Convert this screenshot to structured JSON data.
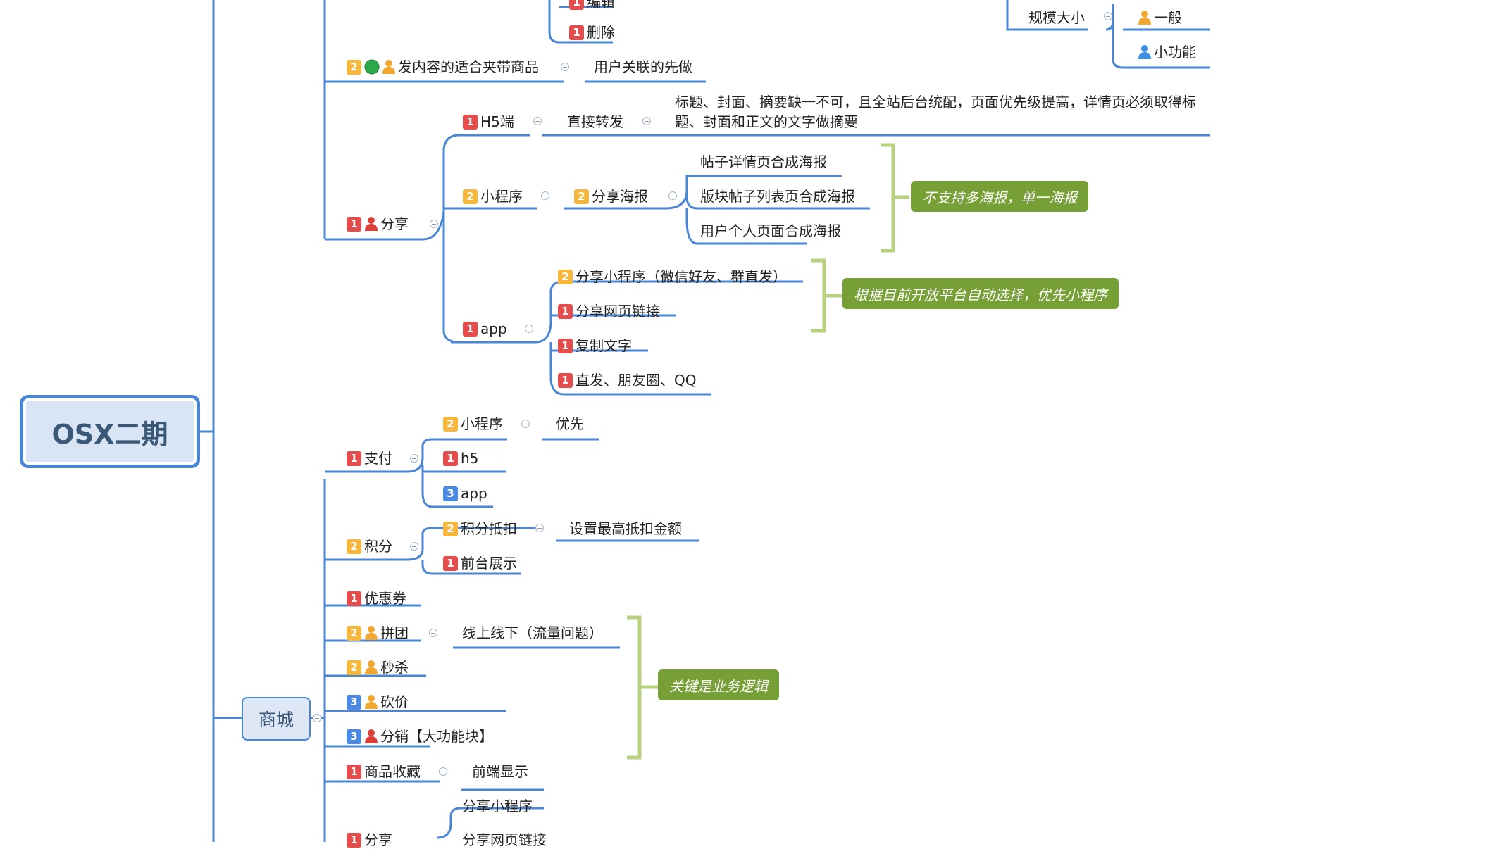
{
  "root": {
    "title": "OSX二期"
  },
  "colors": {
    "line": "#4a86d4",
    "brace": "#b7d17e",
    "note_bg": "#76a035",
    "p1": "#e54d4d",
    "p2": "#f6b73c",
    "p3": "#4a8ae2"
  },
  "top": {
    "edit": "编辑",
    "delete": "删除",
    "scale": "规模大小",
    "normal": "一般",
    "small_feature": "小功能",
    "content_goods": "发内容的适合夹带商品",
    "user_related": "用户关联的先做"
  },
  "share": {
    "label": "分享",
    "h5": "H5端",
    "direct_forward": "直接转发",
    "h5_note": "标题、封面、摘要缺一不可，且全站后台统配，页面优先级提高，详情页必须取得标题、封面和正文的文字做摘要",
    "miniprogram": "小程序",
    "share_poster": "分享海报",
    "poster_items": [
      "帖子详情页合成海报",
      "版块帖子列表页合成海报",
      "用户个人页面合成海报"
    ],
    "poster_note": "不支持多海报，单一海报",
    "app": "app",
    "app_items": [
      "分享小程序（微信好友、群直发）",
      "分享网页链接",
      "复制文字",
      "直发、朋友圈、QQ"
    ],
    "app_note": "根据目前开放平台自动选择，优先小程序"
  },
  "mall": {
    "label": "商城",
    "pay": "支付",
    "pay_items": [
      "小程序",
      "h5",
      "app"
    ],
    "priority": "优先",
    "points": "积分",
    "points_deduct": "积分抵扣",
    "max_deduct": "设置最高抵扣金额",
    "front_show": "前台展示",
    "coupon": "优惠券",
    "group": "拼团",
    "online_offline": "线上线下（流量问题）",
    "seckill": "秒杀",
    "bargain": "砍价",
    "distribution": "分销【大功能块】",
    "biz_note": "关键是业务逻辑",
    "favorite": "商品收藏",
    "frontend_show": "前端显示",
    "share": "分享",
    "share_items": [
      "分享小程序",
      "分享网页链接"
    ]
  }
}
